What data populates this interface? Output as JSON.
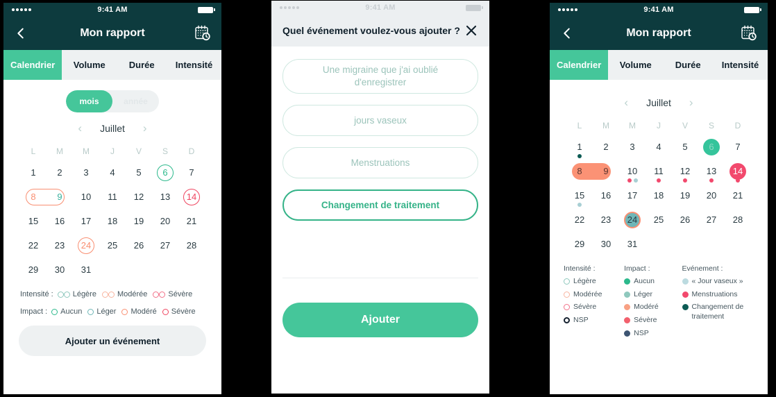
{
  "colors": {
    "dark_teal": "#0d3b3e",
    "mint": "#45c69a",
    "green": "#2cb98c",
    "pink": "#f2496d",
    "salmon": "#f98f72",
    "light_blue": "#a8cfd4",
    "deep_teal": "#0c5b54",
    "navy": "#3d5472",
    "red": "#ef4560"
  },
  "status_bar": {
    "time": "9:41 AM",
    "signal_dots": 5
  },
  "panel1": {
    "nav": {
      "back_label": "‹",
      "title": "Mon rapport",
      "right_icon": "calendar-clock-icon"
    },
    "tabs": [
      {
        "label": "Calendrier",
        "active": true
      },
      {
        "label": "Volume",
        "active": false
      },
      {
        "label": "Durée",
        "active": false
      },
      {
        "label": "Intensité",
        "active": false
      }
    ],
    "range_toggle": {
      "selected": "mois",
      "other": "année"
    },
    "month_nav": {
      "prev": "‹",
      "label": "Juillet",
      "next": "›"
    },
    "weekdays": [
      "L",
      "M",
      "M",
      "J",
      "V",
      "S",
      "D"
    ],
    "weeks": [
      [
        {
          "d": "1"
        },
        {
          "d": "2"
        },
        {
          "d": "3"
        },
        {
          "d": "4"
        },
        {
          "d": "5"
        },
        {
          "d": "6",
          "style": "ring-green"
        },
        {
          "d": "7"
        }
      ],
      [
        {
          "d": "8",
          "style": "pill-start",
          "variant": "outline"
        },
        {
          "d": "9",
          "style": "pill-end",
          "variant": "outline"
        },
        {
          "d": "10"
        },
        {
          "d": "11"
        },
        {
          "d": "12"
        },
        {
          "d": "13"
        },
        {
          "d": "14",
          "style": "ring-red"
        }
      ],
      [
        {
          "d": "15"
        },
        {
          "d": "16"
        },
        {
          "d": "17"
        },
        {
          "d": "18"
        },
        {
          "d": "19"
        },
        {
          "d": "20"
        },
        {
          "d": "21"
        }
      ],
      [
        {
          "d": "22"
        },
        {
          "d": "23"
        },
        {
          "d": "24",
          "style": "ring-salmon"
        },
        {
          "d": "25"
        },
        {
          "d": "26"
        },
        {
          "d": "27"
        },
        {
          "d": "28"
        }
      ],
      [
        {
          "d": "29"
        },
        {
          "d": "30"
        },
        {
          "d": "31"
        },
        {
          "d": ""
        },
        {
          "d": ""
        },
        {
          "d": ""
        },
        {
          "d": ""
        }
      ]
    ],
    "legend": {
      "intensity_title": "Intensité :",
      "intensity_items": [
        {
          "label": "Légère",
          "color": "#8fc8bd"
        },
        {
          "label": "Modérée",
          "color": "#f8b5a0"
        },
        {
          "label": "Sévère",
          "color": "#f2728a"
        }
      ],
      "impact_title": "Impact :",
      "impact_items": [
        {
          "label": "Aucun",
          "color": "#2cb98c"
        },
        {
          "label": "Léger",
          "color": "#6fb6b7"
        },
        {
          "label": "Modéré",
          "color": "#f98f72"
        },
        {
          "label": "Sévère",
          "color": "#ef4560"
        }
      ]
    },
    "add_button": "Ajouter un événement"
  },
  "panel2": {
    "title": "Quel événement voulez-vous ajouter ?",
    "close_icon": "close-icon",
    "options": [
      {
        "label": "Une migraine que j'ai oublié d'enregistrer",
        "selected": false
      },
      {
        "label": "jours vaseux",
        "selected": false
      },
      {
        "label": "Menstruations",
        "selected": false
      },
      {
        "label": "Changement de traitement",
        "selected": true
      }
    ],
    "submit_label": "Ajouter"
  },
  "panel3": {
    "nav": {
      "back_label": "‹",
      "title": "Mon rapport",
      "right_icon": "calendar-clock-icon"
    },
    "tabs": [
      {
        "label": "Calendrier",
        "active": true
      },
      {
        "label": "Volume",
        "active": false
      },
      {
        "label": "Durée",
        "active": false
      },
      {
        "label": "Intensité",
        "active": false
      }
    ],
    "month_nav": {
      "prev": "‹",
      "label": "Juillet",
      "next": "›"
    },
    "weekdays": [
      "L",
      "M",
      "M",
      "J",
      "V",
      "S",
      "D"
    ],
    "weeks": [
      [
        {
          "d": "1",
          "dots": [
            "#0c5b54"
          ]
        },
        {
          "d": "2"
        },
        {
          "d": "3"
        },
        {
          "d": "4"
        },
        {
          "d": "5"
        },
        {
          "d": "6",
          "style": "fill-green"
        },
        {
          "d": "7"
        }
      ],
      [
        {
          "d": "8",
          "style": "pill-start",
          "variant": "fill"
        },
        {
          "d": "9",
          "style": "pill-end",
          "variant": "fill"
        },
        {
          "d": "10",
          "dots": [
            "#f2496d",
            "#a8cfd4"
          ]
        },
        {
          "d": "11",
          "dots": [
            "#f2496d"
          ]
        },
        {
          "d": "12",
          "dots": [
            "#f2496d"
          ]
        },
        {
          "d": "13",
          "dots": [
            "#f2496d"
          ]
        },
        {
          "d": "14",
          "style": "fill-pink",
          "dots": [
            "#f2496d"
          ]
        }
      ],
      [
        {
          "d": "15",
          "dots": [
            "#a8cfd4"
          ]
        },
        {
          "d": "16"
        },
        {
          "d": "17"
        },
        {
          "d": "18"
        },
        {
          "d": "19"
        },
        {
          "d": "20"
        },
        {
          "d": "21"
        }
      ],
      [
        {
          "d": "22"
        },
        {
          "d": "23"
        },
        {
          "d": "24",
          "style": "fill-teal"
        },
        {
          "d": "25"
        },
        {
          "d": "26"
        },
        {
          "d": "27"
        },
        {
          "d": "28"
        }
      ],
      [
        {
          "d": "29"
        },
        {
          "d": "30"
        },
        {
          "d": "31"
        },
        {
          "d": ""
        },
        {
          "d": ""
        },
        {
          "d": ""
        },
        {
          "d": ""
        }
      ]
    ],
    "legend": {
      "col1_title": "Intensité :",
      "col1": [
        {
          "label": "Légère",
          "color": "#8fc8bd",
          "kind": "ring"
        },
        {
          "label": "Modérée",
          "color": "#f8b5a0",
          "kind": "ring"
        },
        {
          "label": "Sévère",
          "color": "#f2728a",
          "kind": "ring"
        },
        {
          "label": "NSP",
          "color": "#14202e",
          "kind": "ring-thick"
        }
      ],
      "col2_title": "Impact :",
      "col2": [
        {
          "label": "Aucun",
          "color": "#2cb98c",
          "kind": "solid"
        },
        {
          "label": "Léger",
          "color": "#8fc8bd",
          "kind": "solid"
        },
        {
          "label": "Modéré",
          "color": "#f8a184",
          "kind": "solid"
        },
        {
          "label": "Sévère",
          "color": "#f2606d",
          "kind": "solid"
        },
        {
          "label": "NSP",
          "color": "#3d5472",
          "kind": "solid"
        }
      ],
      "col3_title": "Evénement :",
      "col3": [
        {
          "label": "« Jour vaseux »",
          "color": "#bcdbe0",
          "kind": "solid"
        },
        {
          "label": "Menstruations",
          "color": "#f2496d",
          "kind": "solid"
        },
        {
          "label": "Changement de traitement",
          "color": "#0c5b54",
          "kind": "solid"
        }
      ]
    }
  }
}
